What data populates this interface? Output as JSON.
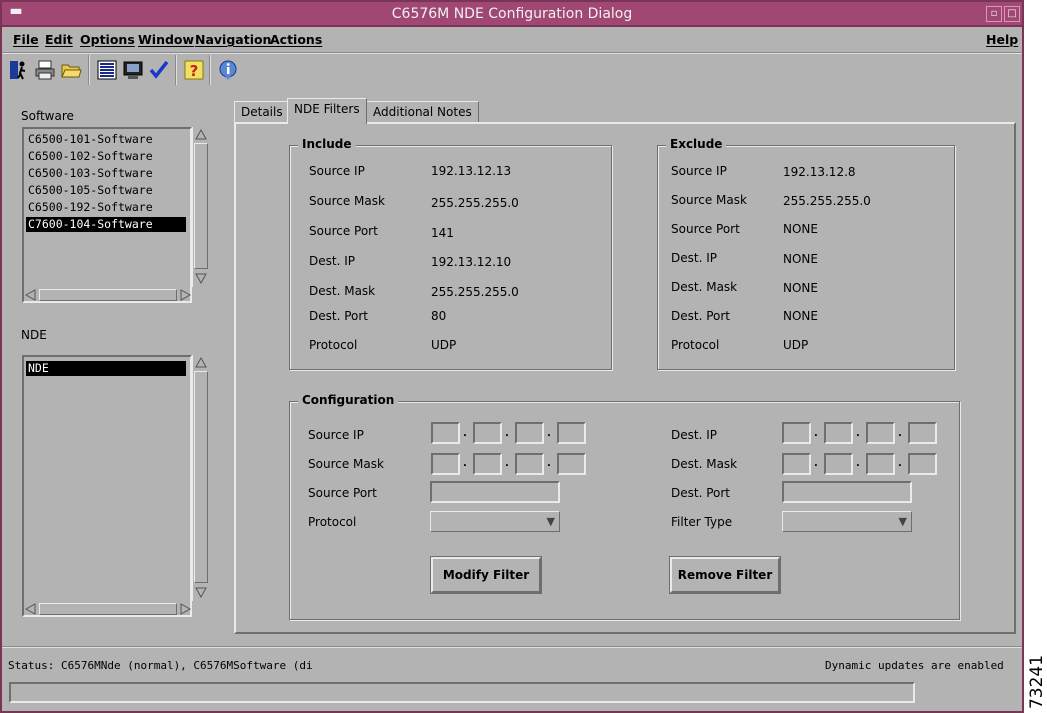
{
  "window": {
    "title": "C6576M NDE Configuration Dialog"
  },
  "menubar": {
    "items": [
      "File",
      "Edit",
      "Options",
      "Window",
      "Navigation",
      "Actions"
    ],
    "help": "Help"
  },
  "toolbar": {
    "icons": [
      "exit-icon",
      "print-icon",
      "open-folder-icon",
      "list-icon",
      "monitor-icon",
      "checkmark-icon",
      "help-icon",
      "info-icon"
    ]
  },
  "sidebar": {
    "software_label": "Software",
    "software_items": [
      "C6500-101-Software",
      "C6500-102-Software",
      "C6500-103-Software",
      "C6500-105-Software",
      "C6500-192-Software",
      "C7600-104-Software"
    ],
    "software_selected": "C7600-104-Software",
    "nde_label": "NDE",
    "nde_items": [
      "NDE"
    ],
    "nde_selected": "NDE"
  },
  "tabs": [
    "Details",
    "NDE Filters",
    "Additional Notes"
  ],
  "active_tab": "NDE Filters",
  "include": {
    "title": "Include",
    "rows": [
      {
        "label": "Source IP",
        "value": "192.13.12.13"
      },
      {
        "label": "Source Mask",
        "value": "255.255.255.0"
      },
      {
        "label": "Source Port",
        "value": "141"
      },
      {
        "label": "Dest. IP",
        "value": "192.13.12.10"
      },
      {
        "label": "Dest. Mask",
        "value": "255.255.255.0"
      },
      {
        "label": "Dest. Port",
        "value": "80"
      },
      {
        "label": "Protocol",
        "value": "UDP"
      }
    ]
  },
  "exclude": {
    "title": "Exclude",
    "rows": [
      {
        "label": "Source IP",
        "value": "192.13.12.8"
      },
      {
        "label": "Source Mask",
        "value": "255.255.255.0"
      },
      {
        "label": "Source Port",
        "value": "NONE"
      },
      {
        "label": "Dest. IP",
        "value": "NONE"
      },
      {
        "label": "Dest. Mask",
        "value": "NONE"
      },
      {
        "label": "Dest. Port",
        "value": "NONE"
      },
      {
        "label": "Protocol",
        "value": "UDP"
      }
    ]
  },
  "configuration": {
    "title": "Configuration",
    "source_ip_label": "Source IP",
    "source_mask_label": "Source Mask",
    "source_port_label": "Source Port",
    "protocol_label": "Protocol",
    "dest_ip_label": "Dest. IP",
    "dest_mask_label": "Dest. Mask",
    "dest_port_label": "Dest. Port",
    "filter_type_label": "Filter Type",
    "source_port_value": "",
    "dest_port_value": "",
    "protocol_value": "",
    "filter_type_value": "",
    "modify_button": "Modify Filter",
    "remove_button": "Remove Filter"
  },
  "status": {
    "left": "Status: C6576MNde (normal), C6576MSoftware (di",
    "right": "Dynamic updates are enabled"
  },
  "figure_number": "73241",
  "colors": {
    "titlebar": "#a04873",
    "window_bg": "#b3b3b3",
    "selection": "#000000"
  }
}
